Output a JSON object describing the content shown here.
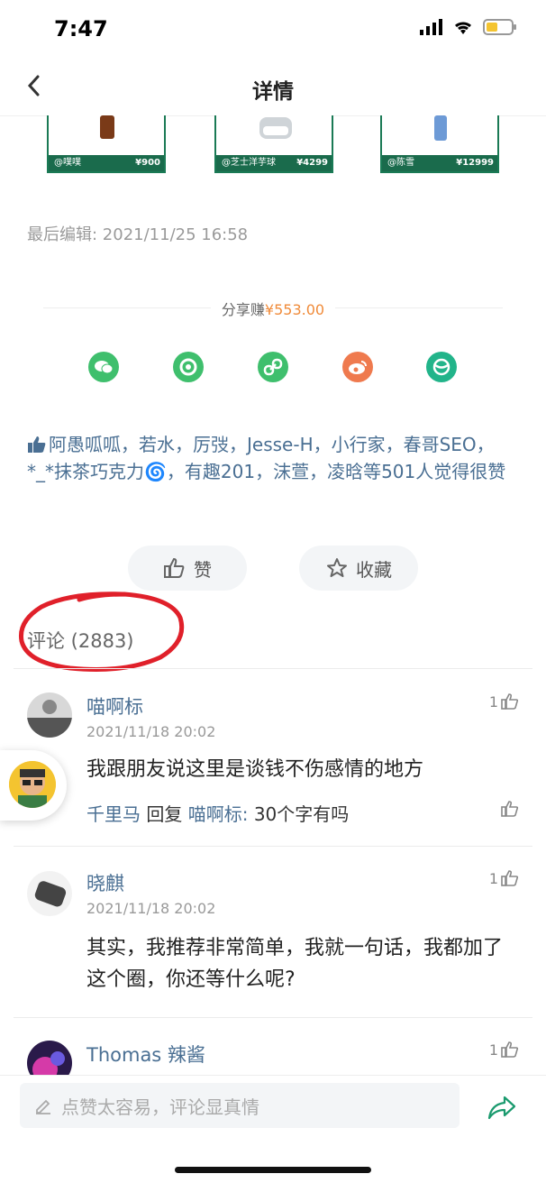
{
  "status_bar": {
    "time": "7:47"
  },
  "nav": {
    "title": "详情"
  },
  "products": [
    {
      "user": "@噗噗",
      "price": "¥900"
    },
    {
      "user": "@芝士洋芋球",
      "price": "¥4299"
    },
    {
      "user": "@陈雪",
      "price": "¥12999"
    }
  ],
  "post": {
    "edit_time": "最后编辑: 2021/11/25 16:58"
  },
  "share": {
    "label": "分享赚",
    "amount": "¥553.00",
    "icons": [
      "wechat-icon",
      "moments-icon",
      "link-icon",
      "weibo-icon",
      "planet-icon"
    ]
  },
  "likes": {
    "text": "阿愚呱呱，若水，厉弢，Jesse-H，小行家，春哥SEO，*_*抹茶巧克力🌀，有趣201，沫萱，凌晗等501人觉得很赞"
  },
  "actions": {
    "like_label": "赞",
    "favorite_label": "收藏"
  },
  "comments": {
    "title": "评论 (2883)",
    "items": [
      {
        "name": "喵啊标",
        "time": "2021/11/18 20:02",
        "text": "我跟朋友说这里是谈钱不伤感情的地方",
        "likes": "1",
        "reply": {
          "from": "千里马",
          "verb": "回复",
          "to": "喵啊标:",
          "text": "30个字有吗"
        }
      },
      {
        "name": "晓麒",
        "time": "2021/11/18 20:02",
        "text": "其实，我推荐非常简单，我就一句话，我都加了这个圈，你还等什么呢?",
        "likes": "1"
      },
      {
        "name": "Thomas 辣酱",
        "likes": "1"
      }
    ]
  },
  "bottom": {
    "placeholder": "点赞太容易，评论显真情"
  },
  "colors": {
    "accent_green": "#1a7a55",
    "link_blue": "#4a6f93",
    "price_orange": "#f08b3a",
    "annotation_red": "#e0202a"
  }
}
